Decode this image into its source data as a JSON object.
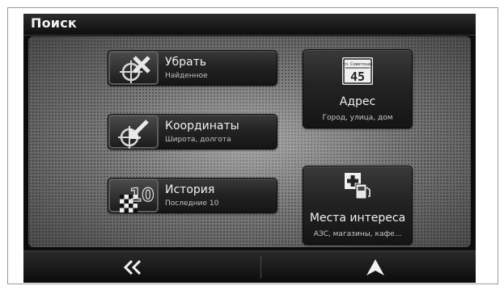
{
  "header": {
    "title": "Поиск"
  },
  "buttons": {
    "remove": {
      "label": "Убрать",
      "sublabel": "Найденное",
      "icon": "crosshair-remove-icon"
    },
    "coordinates": {
      "label": "Координаты",
      "sublabel": "Широта, долгота",
      "icon": "crosshair-arrow-icon"
    },
    "history": {
      "label": "История",
      "sublabel": "Последние 10",
      "icon": "history-ten-icon",
      "icon_text": "10"
    },
    "address": {
      "label": "Адрес",
      "sublabel": "Город, улица, дом",
      "icon": "street-sign-icon",
      "sign_top": "ул. Советская",
      "sign_number": "45"
    },
    "poi": {
      "label": "Места интереса",
      "sublabel": "АЗС, магазины, кафе...",
      "icon": "fuel-hospital-icon"
    }
  },
  "footer": {
    "back_icon": "double-chevron-left-icon",
    "map_icon": "navigation-arrow-icon"
  }
}
